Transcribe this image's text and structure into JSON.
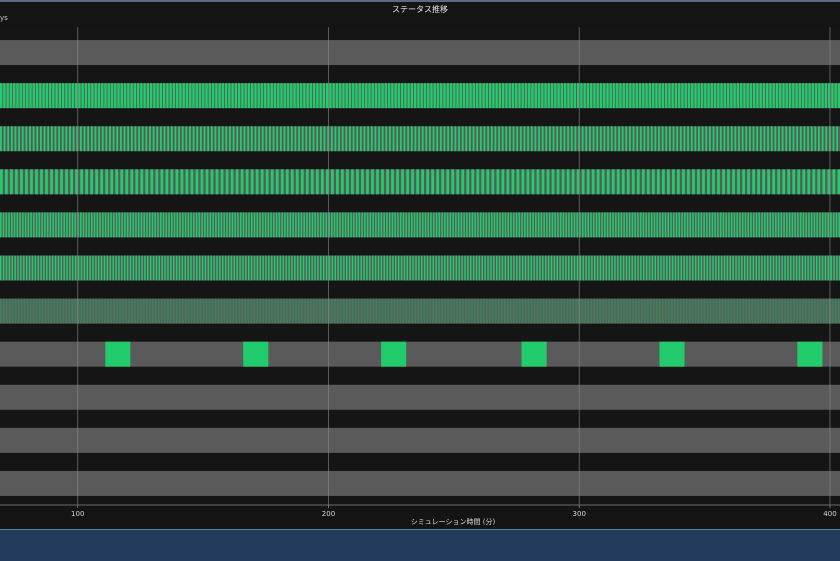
{
  "page": {
    "title": "ステータス推移",
    "header_row_label": "ys",
    "footer_color": "#233b5b"
  },
  "chart_data": {
    "type": "timeline",
    "title": "ステータス推移",
    "xlabel": "シミュレーション時間 (分)",
    "xlim": [
      69,
      404
    ],
    "xticks": [
      100,
      200,
      300,
      400
    ],
    "grid": true,
    "colors": {
      "active": "#22cc6c",
      "idle": "#5a5a5a",
      "dim_active": "#3c8a5c"
    },
    "rows": [
      {
        "row": 1,
        "pattern": "idle"
      },
      {
        "row": 2,
        "pattern": "periodic",
        "period": 1.3,
        "duty": 0.72
      },
      {
        "row": 3,
        "pattern": "periodic",
        "period": 1.45,
        "duty": 0.5
      },
      {
        "row": 4,
        "pattern": "periodic",
        "period": 2.0,
        "duty": 0.55
      },
      {
        "row": 5,
        "pattern": "periodic",
        "period": 1.1,
        "duty": 0.55
      },
      {
        "row": 6,
        "pattern": "periodic",
        "period": 1.15,
        "duty": 0.5
      },
      {
        "row": 7,
        "pattern": "periodic",
        "period": 0.6,
        "duty": 0.5,
        "dim": true
      },
      {
        "row": 8,
        "pattern": "blocks",
        "blocks": [
          [
            111,
            121
          ],
          [
            166,
            176
          ],
          [
            221,
            231
          ],
          [
            277,
            287
          ],
          [
            332,
            342
          ],
          [
            387,
            397
          ]
        ]
      },
      {
        "row": 9,
        "pattern": "idle"
      },
      {
        "row": 10,
        "pattern": "idle"
      },
      {
        "row": 11,
        "pattern": "idle"
      }
    ]
  }
}
